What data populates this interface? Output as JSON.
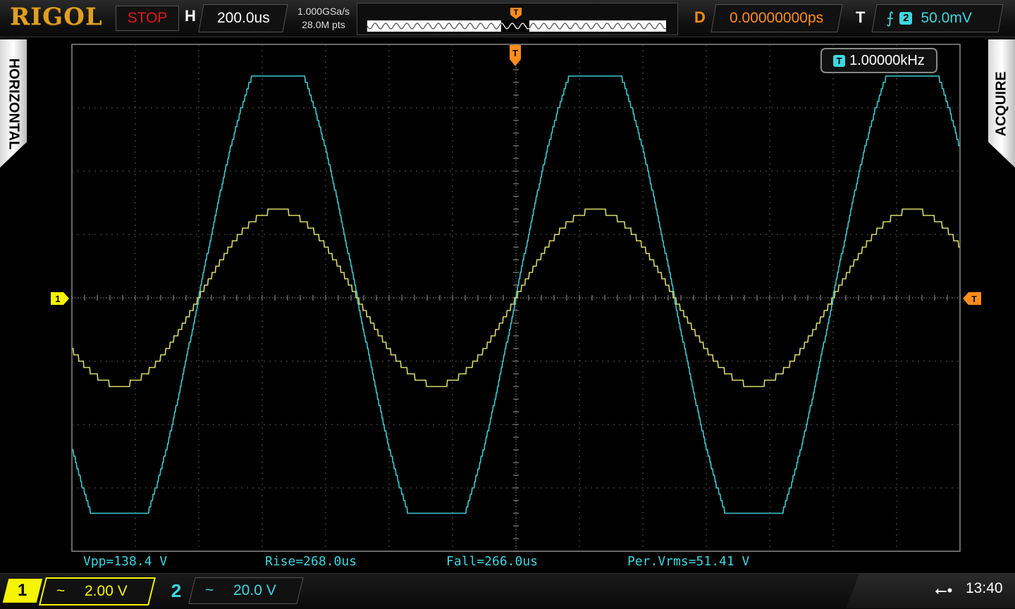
{
  "topbar": {
    "brand": "RIGOL",
    "run_status": "STOP",
    "h_label": "H",
    "timebase": "200.0us",
    "sample_rate": "1.000GSa/s",
    "memory_depth": "28.0M pts",
    "d_label": "D",
    "delay": "0.00000000ps",
    "t_label": "T",
    "trigger_source": "2",
    "trigger_level": "50.0mV",
    "trigger_edge_icon": "rising-edge-icon"
  },
  "side_tabs": {
    "left": "HORIZONTAL",
    "right": "ACQUIRE"
  },
  "frequency_counter": {
    "badge": "T",
    "value": "1.00000kHz"
  },
  "markers": {
    "trigger_position": "T",
    "ch1_ground": "1",
    "trigger_level": "T"
  },
  "measurements": [
    {
      "text": "Vpp=138.4 V"
    },
    {
      "text": "Rise=268.0us"
    },
    {
      "text": "Fall=266.0us"
    },
    {
      "text": "Per.Vrms=51.41 V"
    }
  ],
  "channels": [
    {
      "number": "1",
      "coupling": "~",
      "scale": "2.00 V",
      "color": "#f5f500"
    },
    {
      "number": "2",
      "coupling": "~",
      "scale": "20.0 V",
      "color": "#3ed6e0"
    }
  ],
  "status": {
    "usb_icon": "usb-icon",
    "time": "13:40"
  },
  "colors": {
    "ch1": "#d8d86a",
    "ch2": "#3ec8d0",
    "trigger": "#ff8c1a",
    "grid": "#5a5a5a",
    "brand": "#e0a020"
  },
  "chart_data": {
    "type": "line",
    "title": "",
    "xlabel": "",
    "ylabel": "",
    "x_unit": "us",
    "grid": true,
    "divisions": {
      "x": 14,
      "y": 8
    },
    "xlim": [
      -1400,
      1400
    ],
    "series": [
      {
        "name": "1",
        "shape": "sine",
        "frequency_hz": 1000,
        "amplitude_div": 1.38,
        "phase_deg": 0
      },
      {
        "name": "2",
        "shape": "clipped-sine",
        "frequency_hz": 1000,
        "amplitude_div": 4.0,
        "clip_div": 3.45,
        "phase_deg": 0
      }
    ]
  }
}
